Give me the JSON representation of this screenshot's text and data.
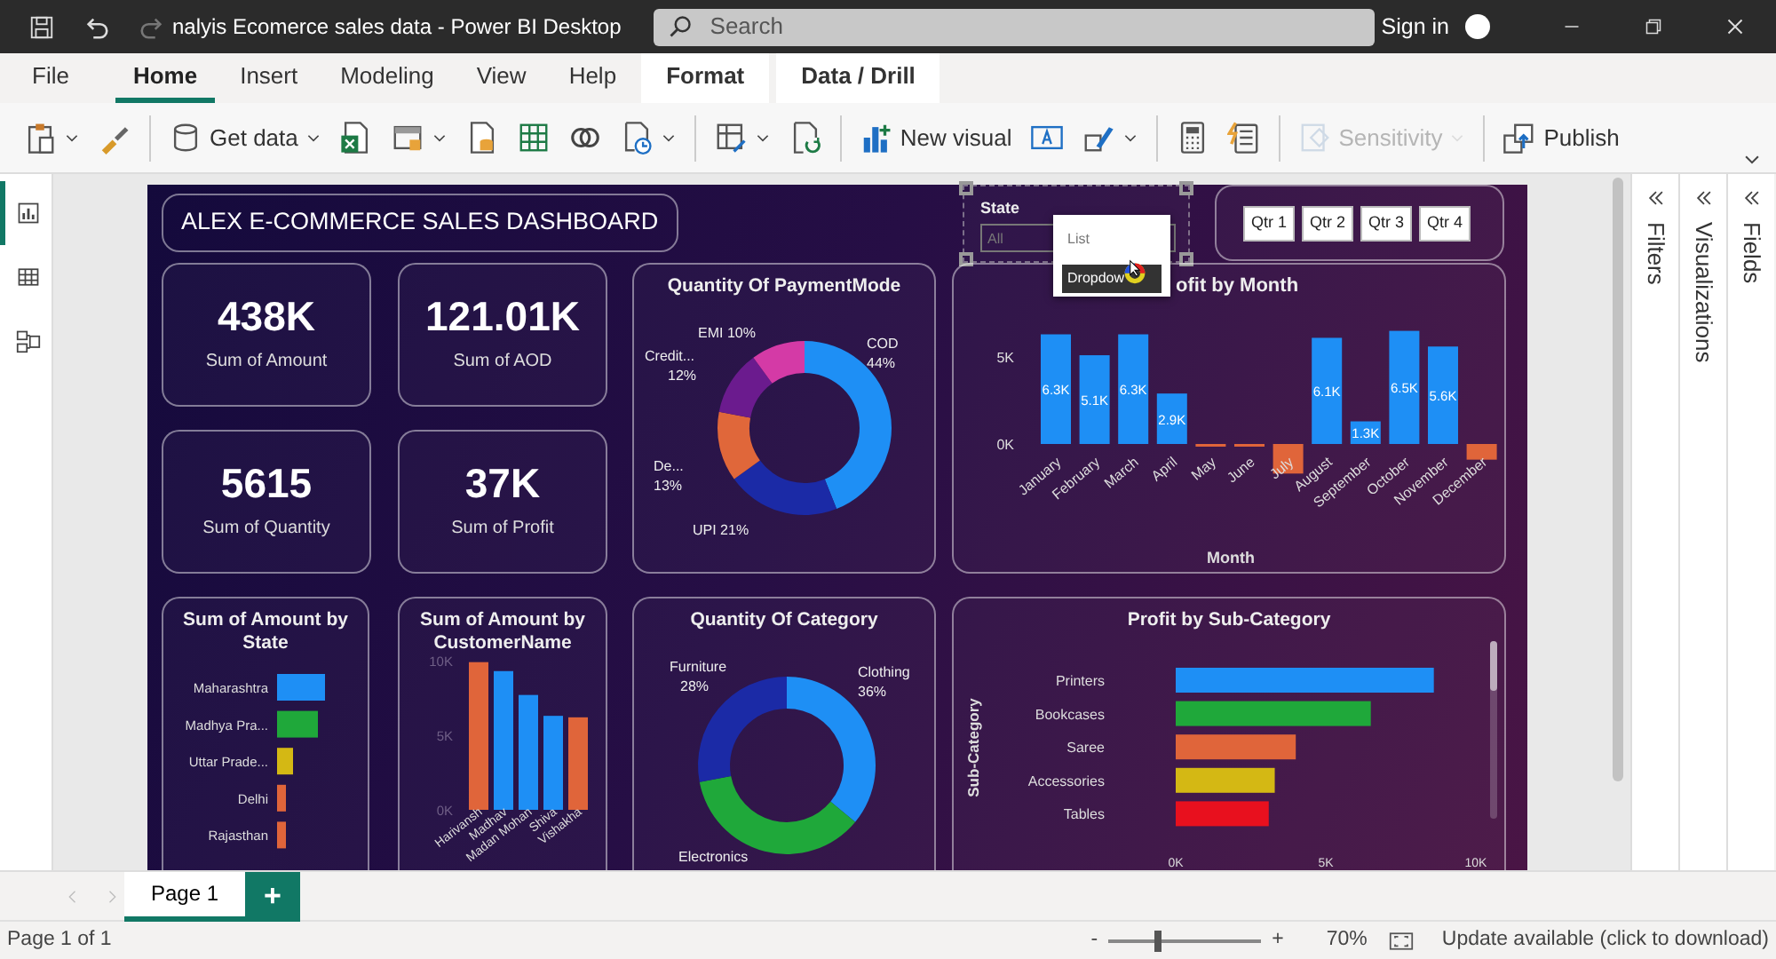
{
  "title_bar": {
    "title": "nalyis Ecomerce sales data - Power BI Desktop",
    "search_placeholder": "Search",
    "sign_in": "Sign in"
  },
  "menu_tabs": [
    {
      "label": "File",
      "selected": false,
      "kind": "main"
    },
    {
      "label": "Home",
      "selected": true,
      "kind": "main"
    },
    {
      "label": "Insert",
      "selected": false,
      "kind": "main"
    },
    {
      "label": "Modeling",
      "selected": false,
      "kind": "main"
    },
    {
      "label": "View",
      "selected": false,
      "kind": "main"
    },
    {
      "label": "Help",
      "selected": false,
      "kind": "main"
    },
    {
      "label": "Format",
      "selected": false,
      "kind": "contextual"
    },
    {
      "label": "Data / Drill",
      "selected": false,
      "kind": "contextual"
    }
  ],
  "ribbon": [
    {
      "group_start": false,
      "dropdown": true,
      "disabled": false
    },
    {
      "group_start": false,
      "dropdown": false,
      "disabled": false
    },
    {
      "group_start": true,
      "label": "Get data",
      "dropdown": true,
      "disabled": false
    },
    {
      "group_start": false,
      "dropdown": false,
      "disabled": false
    },
    {
      "group_start": false,
      "dropdown": true,
      "disabled": false
    },
    {
      "group_start": false,
      "dropdown": false,
      "disabled": false
    },
    {
      "group_start": false,
      "dropdown": false,
      "disabled": false
    },
    {
      "group_start": false,
      "dropdown": false,
      "disabled": false
    },
    {
      "group_start": false,
      "dropdown": true,
      "disabled": false
    },
    {
      "group_start": true,
      "dropdown": true,
      "disabled": false
    },
    {
      "group_start": false,
      "dropdown": false,
      "disabled": false
    },
    {
      "group_start": true,
      "label": "New visual",
      "dropdown": false,
      "disabled": false
    },
    {
      "group_start": false,
      "dropdown": false,
      "disabled": false
    },
    {
      "group_start": false,
      "dropdown": true,
      "disabled": false
    },
    {
      "group_start": true,
      "dropdown": false,
      "disabled": false
    },
    {
      "group_start": false,
      "dropdown": false,
      "disabled": false
    },
    {
      "group_start": true,
      "label": "Sensitivity",
      "dropdown": true,
      "disabled": true
    },
    {
      "group_start": true,
      "label": "Publish",
      "dropdown": false,
      "disabled": false
    }
  ],
  "nav_rail": [
    {
      "selected": true
    },
    {
      "selected": false
    },
    {
      "selected": false
    }
  ],
  "dashboard": {
    "title": "ALEX E-COMMERCE SALES DASHBOARD",
    "kpis": [
      {
        "value": "438K",
        "label": "Sum of Amount"
      },
      {
        "value": "121.01K",
        "label": "Sum of AOD"
      },
      {
        "value": "5615",
        "label": "Sum of Quantity"
      },
      {
        "value": "37K",
        "label": "Sum of Profit"
      }
    ],
    "state_slicer": {
      "label": "State",
      "placeholder": "All",
      "menu": [
        {
          "label": "List",
          "selected": false
        },
        {
          "label": "Dropdow",
          "selected": true
        }
      ]
    },
    "quarter_slicer": {
      "buttons": [
        "Qtr 1",
        "Qtr 2",
        "Qtr 3",
        "Qtr 4"
      ]
    },
    "payment_chart": {
      "chart_data": {
        "type": "donut",
        "title": "Quantity Of PaymentMode",
        "categories": [
          "COD",
          "UPI",
          "De...",
          "Credit...",
          "EMI"
        ],
        "values": [
          44,
          21,
          13,
          12,
          10
        ],
        "colors": [
          "#1e8ff5",
          "#1b2aa6",
          "#e0673a",
          "#6b1b8e",
          "#d43aa6"
        ],
        "value_labels": [
          "44%",
          "21%",
          "13%",
          "12%",
          "10%"
        ]
      }
    },
    "month_chart": {
      "chart_data": {
        "type": "bar",
        "title": "ofit by Month",
        "xlabel": "Month",
        "categories": [
          "January",
          "February",
          "March",
          "April",
          "May",
          "June",
          "July",
          "August",
          "September",
          "October",
          "November",
          "December"
        ],
        "values": [
          6300,
          5100,
          6300,
          2900,
          -100,
          -100,
          -1700,
          6100,
          1300,
          6500,
          5600,
          -900
        ],
        "colors": [
          "#1e8ff5",
          "#1e8ff5",
          "#1e8ff5",
          "#1e8ff5",
          "#e0653a",
          "#e0653a",
          "#e0653a",
          "#1e8ff5",
          "#1e8ff5",
          "#1e8ff5",
          "#1e8ff5",
          "#e0653a"
        ],
        "ylim": [
          -2000,
          7000
        ],
        "yticks": [
          {
            "value": 0,
            "label": "0K"
          },
          {
            "value": 5000,
            "label": "5K"
          }
        ],
        "value_labels": [
          "6.3K",
          "5.1K",
          "6.3K",
          "2.9K",
          null,
          null,
          null,
          "6.1K",
          "1.3K",
          "6.5K",
          "5.6K",
          null
        ]
      }
    },
    "state_chart": {
      "title": "Sum of Amount by State",
      "bars": [
        {
          "label": "Maharashtra",
          "color": "#1e8ff5"
        },
        {
          "label": "Madhya Pra...",
          "color": "#1fa83a"
        },
        {
          "label": "Uttar Prade...",
          "color": "#d4b814"
        },
        {
          "label": "Delhi",
          "color": "#e0653a"
        },
        {
          "label": "Rajasthan",
          "color": "#e0653a"
        }
      ]
    },
    "customer_chart": {
      "chart_data": {
        "type": "bar",
        "title": "Sum of Amount by CustomerName",
        "categories": [
          "Harivansh",
          "Madhav",
          "Madan Mohan",
          "Shiva",
          "Vishakha"
        ],
        "values": [
          9900,
          9300,
          7700,
          6300,
          6200
        ],
        "colors": [
          "#e0653a",
          "#1e8ff5",
          "#1e8ff5",
          "#1e8ff5",
          "#e0653a"
        ],
        "ylim": [
          0,
          10000
        ],
        "yticks": [
          {
            "value": 0,
            "label": "0K"
          },
          {
            "value": 5000,
            "label": "5K"
          },
          {
            "value": 10000,
            "label": "10K"
          }
        ]
      }
    },
    "category_chart": {
      "chart_data": {
        "type": "donut",
        "title": "Quantity Of Category",
        "categories": [
          "Clothing",
          "Electronics",
          "Furniture"
        ],
        "values": [
          36,
          36,
          28
        ],
        "colors": [
          "#1e8ff5",
          "#1fa83a",
          "#1b2aa6"
        ],
        "value_labels": [
          "36%",
          null,
          "28%"
        ]
      }
    },
    "subcategory_chart": {
      "chart_data": {
        "type": "bar",
        "orientation": "horizontal",
        "title": "Profit by Sub-Category",
        "ylabel": "Sub-Category",
        "categories": [
          "Printers",
          "Bookcases",
          "Saree",
          "Accessories",
          "Tables"
        ],
        "values": [
          8600,
          6500,
          4000,
          3300,
          3100
        ],
        "colors": [
          "#1e8ff5",
          "#1fa83a",
          "#e0653a",
          "#d4b814",
          "#e8101e"
        ],
        "xlim": [
          0,
          10000
        ],
        "xticks": [
          {
            "value": 0,
            "label": "0K"
          },
          {
            "value": 5000,
            "label": "5K"
          },
          {
            "value": 10000,
            "label": "10K"
          }
        ]
      }
    }
  },
  "panes": [
    {
      "label": "Filters"
    },
    {
      "label": "Visualizations"
    },
    {
      "label": "Fields"
    }
  ],
  "page_tabs": [
    {
      "label": "Page 1",
      "selected": true
    }
  ],
  "add_page": "+",
  "status_bar": {
    "page": "Page 1 of 1",
    "zoom_out": "-",
    "zoom_in": "+",
    "zoom": {
      "level": 0.32
    },
    "zoom_text": "70%",
    "update": "Update available (click to download)"
  }
}
